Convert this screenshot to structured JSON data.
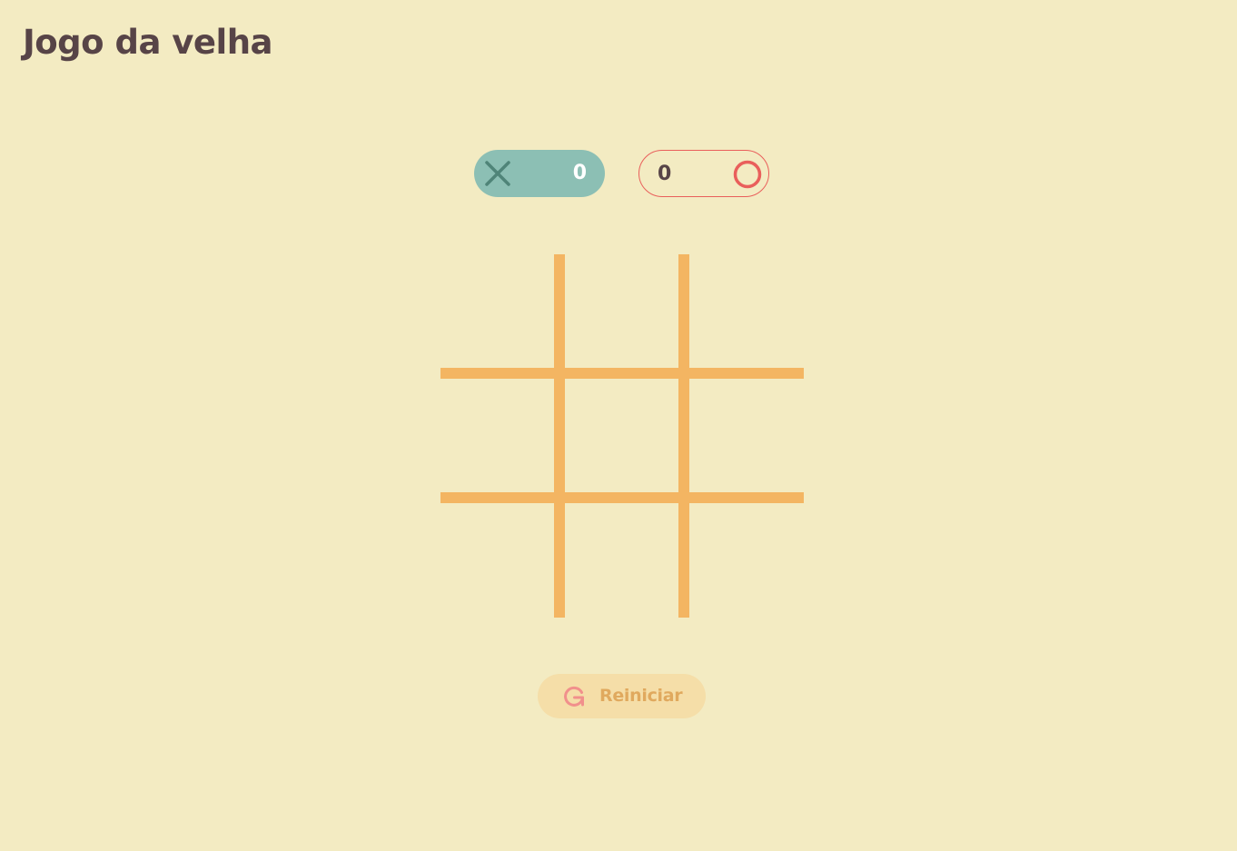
{
  "header": {
    "title": "Jogo da velha"
  },
  "scores": {
    "x": {
      "symbol_icon": "x-mark-icon",
      "value": "0"
    },
    "o": {
      "symbol_icon": "o-ring-icon",
      "value": "0"
    }
  },
  "board": {
    "cells": [
      "",
      "",
      "",
      "",
      "",
      "",
      "",
      "",
      ""
    ]
  },
  "controls": {
    "restart_label": "Reiniciar",
    "restart_icon": "restart-icon"
  },
  "colors": {
    "background": "#f3ebc2",
    "grid_lines": "#f3b562",
    "x_accent": "#8cbfb4",
    "x_mark": "#4f8478",
    "o_accent": "#e95f5b",
    "text": "#574447",
    "restart_bg": "#f5dea8",
    "restart_text": "#e0a95e"
  }
}
